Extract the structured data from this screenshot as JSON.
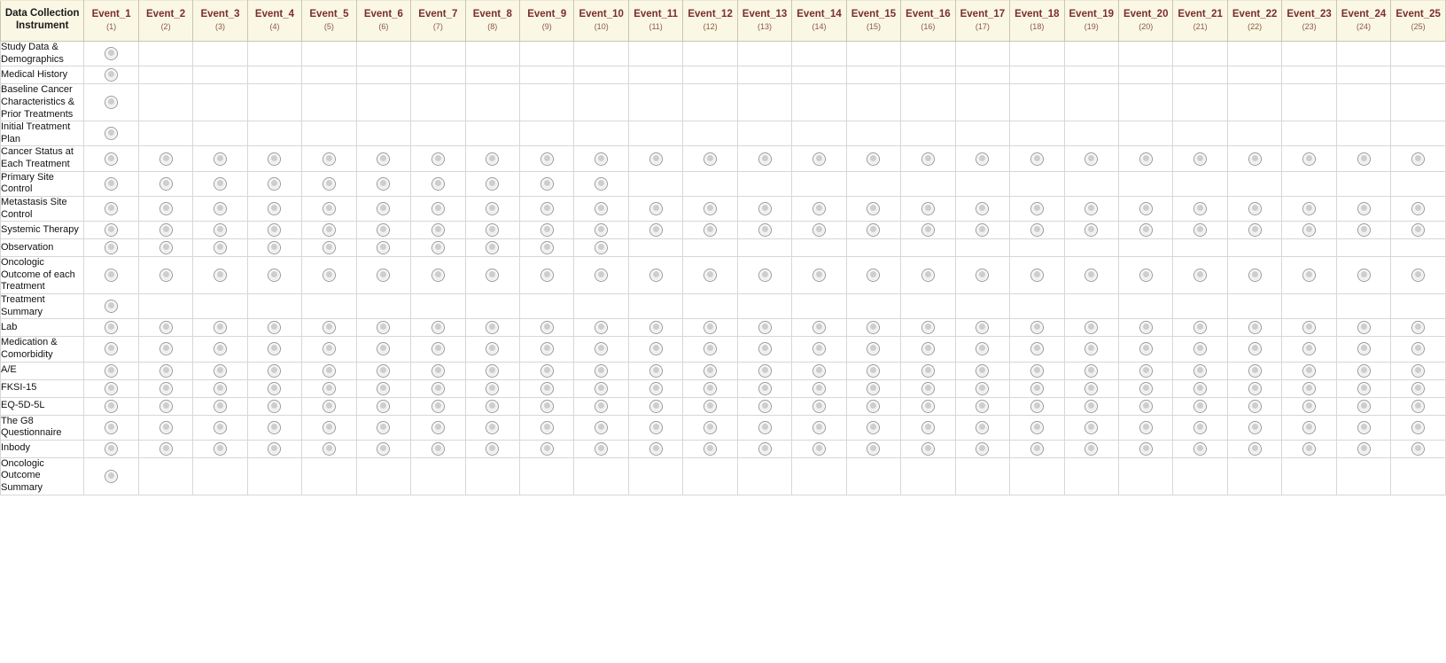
{
  "table": {
    "instrument_column_header": "Data Collection Instrument",
    "event_number_prefix": "Event_",
    "events": [
      {
        "label": "Event_1",
        "number": "(1)"
      },
      {
        "label": "Event_2",
        "number": "(2)"
      },
      {
        "label": "Event_3",
        "number": "(3)"
      },
      {
        "label": "Event_4",
        "number": "(4)"
      },
      {
        "label": "Event_5",
        "number": "(5)"
      },
      {
        "label": "Event_6",
        "number": "(6)"
      },
      {
        "label": "Event_7",
        "number": "(7)"
      },
      {
        "label": "Event_8",
        "number": "(8)"
      },
      {
        "label": "Event_9",
        "number": "(9)"
      },
      {
        "label": "Event_10",
        "number": "(10)"
      },
      {
        "label": "Event_11",
        "number": "(11)"
      },
      {
        "label": "Event_12",
        "number": "(12)"
      },
      {
        "label": "Event_13",
        "number": "(13)"
      },
      {
        "label": "Event_14",
        "number": "(14)"
      },
      {
        "label": "Event_15",
        "number": "(15)"
      },
      {
        "label": "Event_16",
        "number": "(16)"
      },
      {
        "label": "Event_17",
        "number": "(17)"
      },
      {
        "label": "Event_18",
        "number": "(18)"
      },
      {
        "label": "Event_19",
        "number": "(19)"
      },
      {
        "label": "Event_20",
        "number": "(20)"
      },
      {
        "label": "Event_21",
        "number": "(21)"
      },
      {
        "label": "Event_22",
        "number": "(22)"
      },
      {
        "label": "Event_23",
        "number": "(23)"
      },
      {
        "label": "Event_24",
        "number": "(24)"
      },
      {
        "label": "Event_25",
        "number": "(25)"
      }
    ],
    "rows": [
      {
        "instrument": "Study Data & Demographics",
        "checked": [
          1
        ]
      },
      {
        "instrument": "Medical History",
        "checked": [
          1
        ]
      },
      {
        "instrument": "Baseline Cancer Characteristics & Prior Treatments",
        "checked": [
          1
        ]
      },
      {
        "instrument": "Initial Treatment Plan",
        "checked": [
          1
        ]
      },
      {
        "instrument": "Cancer Status at Each Treatment",
        "checked": [
          1,
          2,
          3,
          4,
          5,
          6,
          7,
          8,
          9,
          10,
          11,
          12,
          13,
          14,
          15,
          16,
          17,
          18,
          19,
          20,
          21,
          22,
          23,
          24,
          25
        ]
      },
      {
        "instrument": "Primary Site Control",
        "checked": [
          1,
          2,
          3,
          4,
          5,
          6,
          7,
          8,
          9,
          10
        ]
      },
      {
        "instrument": "Metastasis Site Control",
        "checked": [
          1,
          2,
          3,
          4,
          5,
          6,
          7,
          8,
          9,
          10,
          11,
          12,
          13,
          14,
          15,
          16,
          17,
          18,
          19,
          20,
          21,
          22,
          23,
          24,
          25
        ]
      },
      {
        "instrument": "Systemic Therapy",
        "checked": [
          1,
          2,
          3,
          4,
          5,
          6,
          7,
          8,
          9,
          10,
          11,
          12,
          13,
          14,
          15,
          16,
          17,
          18,
          19,
          20,
          21,
          22,
          23,
          24,
          25
        ]
      },
      {
        "instrument": "Observation",
        "checked": [
          1,
          2,
          3,
          4,
          5,
          6,
          7,
          8,
          9,
          10
        ]
      },
      {
        "instrument": "Oncologic Outcome of each Treatment",
        "checked": [
          1,
          2,
          3,
          4,
          5,
          6,
          7,
          8,
          9,
          10,
          11,
          12,
          13,
          14,
          15,
          16,
          17,
          18,
          19,
          20,
          21,
          22,
          23,
          24,
          25
        ]
      },
      {
        "instrument": "Treatment Summary",
        "checked": [
          1
        ]
      },
      {
        "instrument": "Lab",
        "checked": [
          1,
          2,
          3,
          4,
          5,
          6,
          7,
          8,
          9,
          10,
          11,
          12,
          13,
          14,
          15,
          16,
          17,
          18,
          19,
          20,
          21,
          22,
          23,
          24,
          25
        ]
      },
      {
        "instrument": "Medication & Comorbidity",
        "checked": [
          1,
          2,
          3,
          4,
          5,
          6,
          7,
          8,
          9,
          10,
          11,
          12,
          13,
          14,
          15,
          16,
          17,
          18,
          19,
          20,
          21,
          22,
          23,
          24,
          25
        ]
      },
      {
        "instrument": "A/E",
        "checked": [
          1,
          2,
          3,
          4,
          5,
          6,
          7,
          8,
          9,
          10,
          11,
          12,
          13,
          14,
          15,
          16,
          17,
          18,
          19,
          20,
          21,
          22,
          23,
          24,
          25
        ]
      },
      {
        "instrument": "FKSI-15",
        "checked": [
          1,
          2,
          3,
          4,
          5,
          6,
          7,
          8,
          9,
          10,
          11,
          12,
          13,
          14,
          15,
          16,
          17,
          18,
          19,
          20,
          21,
          22,
          23,
          24,
          25
        ]
      },
      {
        "instrument": "EQ-5D-5L",
        "checked": [
          1,
          2,
          3,
          4,
          5,
          6,
          7,
          8,
          9,
          10,
          11,
          12,
          13,
          14,
          15,
          16,
          17,
          18,
          19,
          20,
          21,
          22,
          23,
          24,
          25
        ]
      },
      {
        "instrument": "The G8 Questionnaire",
        "checked": [
          1,
          2,
          3,
          4,
          5,
          6,
          7,
          8,
          9,
          10,
          11,
          12,
          13,
          14,
          15,
          16,
          17,
          18,
          19,
          20,
          21,
          22,
          23,
          24,
          25
        ]
      },
      {
        "instrument": "Inbody",
        "checked": [
          1,
          2,
          3,
          4,
          5,
          6,
          7,
          8,
          9,
          10,
          11,
          12,
          13,
          14,
          15,
          16,
          17,
          18,
          19,
          20,
          21,
          22,
          23,
          24,
          25
        ]
      },
      {
        "instrument": "Oncologic Outcome Summary",
        "checked": [
          1
        ]
      }
    ]
  },
  "colors": {
    "header_background": "#FAF7E4",
    "header_event_text": "#7A2F2B",
    "header_instrument_text": "#1A1A1A",
    "grid_line": "#D7D7D7",
    "radio_border": "#9A9A9A"
  },
  "icons": {
    "radio": "radio-button-icon"
  }
}
